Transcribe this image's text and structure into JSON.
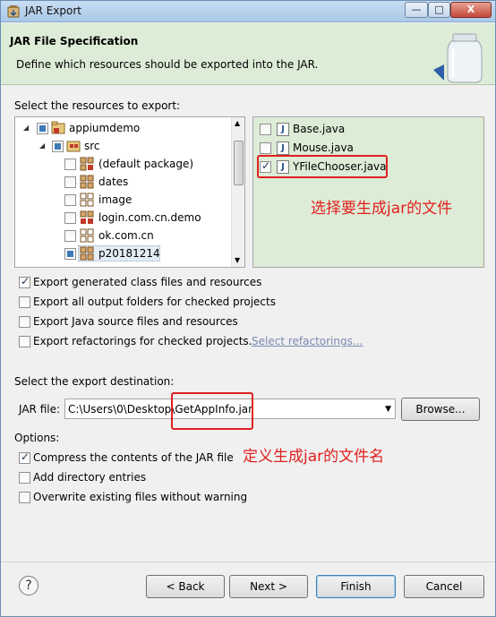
{
  "window": {
    "title": "JAR Export",
    "minimize_label": "—",
    "maximize_label": "□",
    "close_label": "X"
  },
  "header": {
    "title": "JAR File Specification",
    "description": "Define which resources should be exported into the JAR."
  },
  "resources": {
    "label": "Select the resources to export:",
    "tree": [
      {
        "label": "appiumdemo",
        "state": "partial",
        "icon": "project-icon"
      },
      {
        "label": "src",
        "state": "partial",
        "icon": "source-folder-icon"
      },
      {
        "label": "(default package)",
        "state": "unchecked",
        "icon": "package-icon"
      },
      {
        "label": "dates",
        "state": "unchecked",
        "icon": "package-icon"
      },
      {
        "label": "image",
        "state": "unchecked",
        "icon": "empty-package-icon"
      },
      {
        "label": "login.com.cn.demo",
        "state": "unchecked",
        "icon": "package-icon"
      },
      {
        "label": "ok.com.cn",
        "state": "unchecked",
        "icon": "empty-package-icon"
      },
      {
        "label": "p20181214",
        "state": "partial",
        "icon": "package-icon"
      }
    ],
    "files": [
      {
        "label": "Base.java",
        "checked": false
      },
      {
        "label": "Mouse.java",
        "checked": false
      },
      {
        "label": "YFileChooser.java",
        "checked": true
      }
    ]
  },
  "annotations": {
    "select_files": "选择要生成jar的文件",
    "define_name": "定义生成jar的文件名"
  },
  "export_options": {
    "generated_class_files": {
      "label": "Export generated class files and resources",
      "checked": true
    },
    "output_folders": {
      "label": "Export all output folders for checked projects",
      "checked": false
    },
    "java_source": {
      "label": "Export Java source files and resources",
      "checked": false
    },
    "refactorings": {
      "label": "Export refactorings for checked projects.",
      "checked": false
    },
    "select_refactorings_link": "Select refactorings..."
  },
  "destination": {
    "label": "Select the export destination:",
    "jar_file_label": "JAR file:",
    "jar_file_value": "C:\\Users\\0\\Desktop\\GetAppInfo.jar",
    "browse_label": "Browse..."
  },
  "options": {
    "label": "Options:",
    "compress": {
      "label": "Compress the contents of the JAR file",
      "checked": true
    },
    "directory_entries": {
      "label": "Add directory entries",
      "checked": false
    },
    "overwrite": {
      "label": "Overwrite existing files without warning",
      "checked": false
    }
  },
  "buttons": {
    "help": "?",
    "back": "< Back",
    "next": "Next >",
    "finish": "Finish",
    "cancel": "Cancel"
  },
  "colors": {
    "header_bg": "#ddecd6",
    "annotation_red": "#e02020",
    "link": "#7a8ab0"
  }
}
